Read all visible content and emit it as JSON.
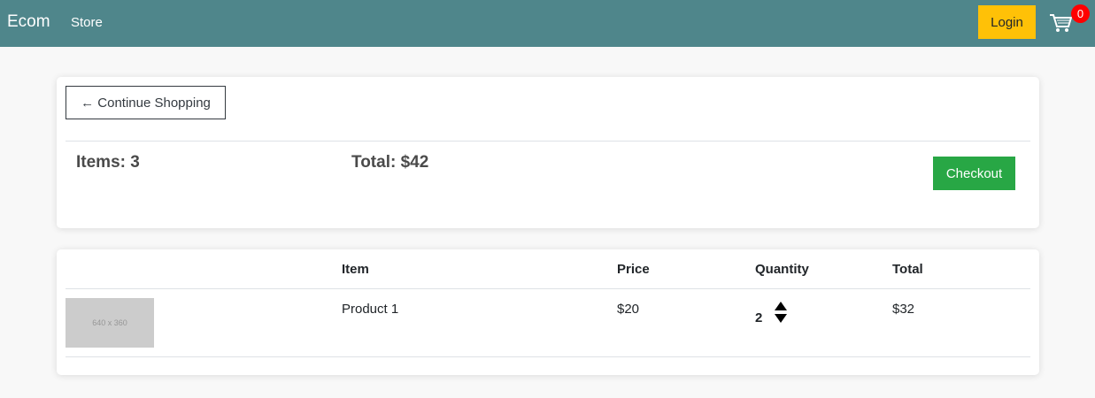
{
  "navbar": {
    "brand": "Ecom",
    "store_link": "Store",
    "login_label": "Login",
    "cart_count": "0",
    "bg_color": "#4f868b"
  },
  "summary": {
    "continue_label": "← Continue Shopping",
    "items_text": "Items: 3",
    "total_text": "Total: $42",
    "checkout_label": "Checkout"
  },
  "cart_table": {
    "headers": [
      "Item",
      "Price",
      "Quantity",
      "Total"
    ],
    "rows": [
      {
        "image_text": "640 x 360",
        "item": "Product 1",
        "price": "$20",
        "quantity": "2",
        "total": "$32"
      }
    ]
  },
  "icons": {
    "cart": "shopping-cart-icon",
    "increase": "arrow-up-icon",
    "decrease": "arrow-down-icon"
  }
}
